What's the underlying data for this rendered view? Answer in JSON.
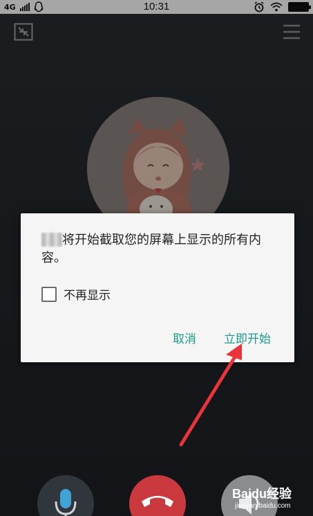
{
  "status_bar": {
    "network": "4G",
    "time": "10:31"
  },
  "dialog": {
    "message": "将开始截取您的屏幕上显示的所有内容。",
    "checkbox_label": "不再显示",
    "checkbox_checked": false,
    "cancel_label": "取消",
    "start_label": "立即开始",
    "button_color": "#1b9a8c"
  },
  "controls": {
    "mic_icon": "microphone-icon",
    "hangup_icon": "phone-hangup-icon",
    "speaker_icon": "speaker-icon"
  },
  "annotation": {
    "arrow_color": "#e8343a"
  },
  "watermark": {
    "title": "Baidu经验",
    "subtitle": "jingyan.baidu.com"
  }
}
